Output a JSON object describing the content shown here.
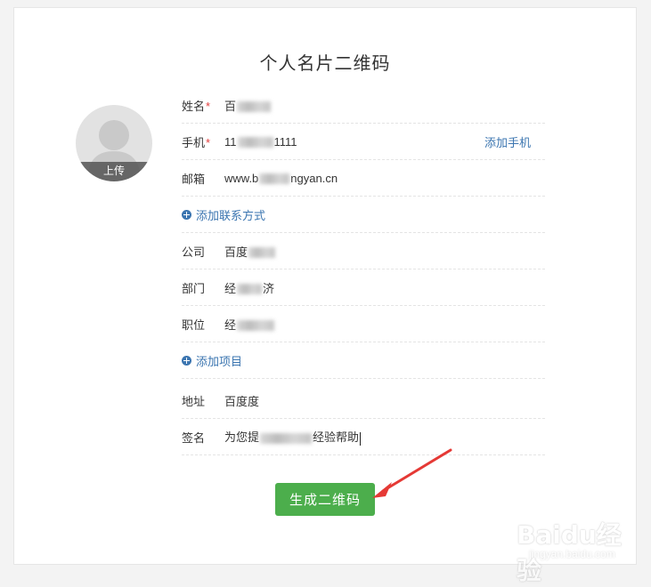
{
  "page_title": "个人名片二维码",
  "avatar": {
    "upload_label": "上传"
  },
  "fields": {
    "name": {
      "label": "姓名",
      "required_mark": "*",
      "value_prefix": "百",
      "value_suffix": ""
    },
    "phone": {
      "label": "手机",
      "required_mark": "*",
      "value_prefix": "11",
      "value_suffix": "1111",
      "side_link": "添加手机"
    },
    "email": {
      "label": "邮箱",
      "value_prefix": "www.b",
      "value_suffix": "ngyan.cn"
    },
    "add_contact": "添加联系方式",
    "company": {
      "label": "公司",
      "value_prefix": "百度"
    },
    "department": {
      "label": "部门",
      "value_prefix": "经",
      "value_suffix": "济"
    },
    "position": {
      "label": "职位",
      "value_prefix": "经"
    },
    "add_item": "添加项目",
    "address": {
      "label": "地址",
      "value": "百度度"
    },
    "signature": {
      "label": "签名",
      "value_prefix": "为您提",
      "value_suffix": "经验帮助"
    }
  },
  "generate_button": "生成二维码",
  "watermark": {
    "logo": "Baidu经验",
    "url": "jingyan.baidu.com"
  },
  "colors": {
    "accent_green": "#4cae4c",
    "link_blue": "#3b75b0",
    "required_red": "#e23b3b",
    "arrow_red": "#e53935"
  }
}
